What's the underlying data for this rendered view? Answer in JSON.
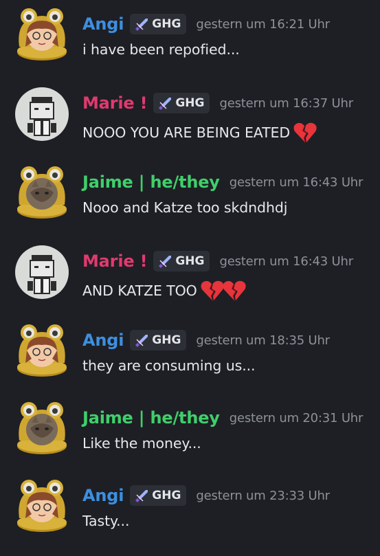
{
  "colors": {
    "background": "#1e1f24",
    "angi": "#3d8fe0",
    "marie": "#e03a6e",
    "jaime": "#3fcf6b",
    "timestamp": "#8d9199",
    "message": "#e6e8ec",
    "tag_bg": "#2c2f36"
  },
  "messages": [
    {
      "user": "Angi",
      "avatar": "frog-hat-character-avatar",
      "tag": "GHG",
      "tag_icon": "sword-icon",
      "time": "gestern um 16:21 Uhr",
      "text": "i have been repofied...",
      "emoji": ""
    },
    {
      "user": "Marie !",
      "avatar": "pixel-character-avatar",
      "tag": "GHG",
      "tag_icon": "sword-icon",
      "time": "gestern um 16:37 Uhr",
      "text": "NOOO YOU ARE BEING EATED",
      "emoji": "broken-heart-icon"
    },
    {
      "user": "Jaime | he/they",
      "avatar": "frog-hat-cat-avatar",
      "tag": "",
      "tag_icon": "",
      "time": "gestern um 16:43 Uhr",
      "text": "Nooo and Katze too skdndhdj",
      "emoji": ""
    },
    {
      "user": "Marie !",
      "avatar": "pixel-character-avatar",
      "tag": "GHG",
      "tag_icon": "sword-icon",
      "time": "gestern um 16:43 Uhr",
      "text": "AND KATZE TOO",
      "emoji": "broken-heart-icon x2"
    },
    {
      "user": "Angi",
      "avatar": "frog-hat-character-avatar",
      "tag": "GHG",
      "tag_icon": "sword-icon",
      "time": "gestern um 18:35 Uhr",
      "text": "they are consuming us...",
      "emoji": ""
    },
    {
      "user": "Jaime | he/they",
      "avatar": "frog-hat-cat-avatar",
      "tag": "",
      "tag_icon": "",
      "time": "gestern um 20:31 Uhr",
      "text": "Like the money...",
      "emoji": ""
    },
    {
      "user": "Angi",
      "avatar": "frog-hat-character-avatar",
      "tag": "GHG",
      "tag_icon": "sword-icon",
      "time": "gestern um 23:33 Uhr",
      "text": "Tasty...",
      "emoji": ""
    }
  ]
}
